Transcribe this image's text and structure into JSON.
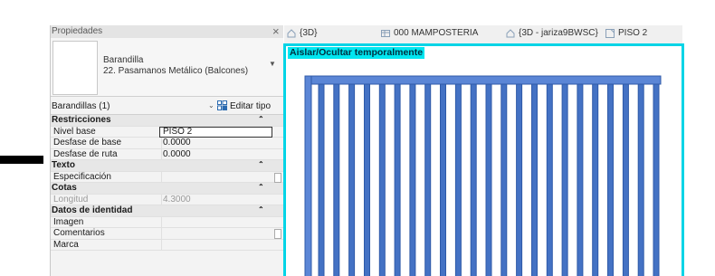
{
  "properties_panel": {
    "title": "Propiedades",
    "close_glyph": "×",
    "type_selector": {
      "family": "Barandilla",
      "type_name": "22. Pasamanos Metálico (Balcones)"
    },
    "instance_filter": "Barandillas (1)",
    "edit_type_label": "Editar tipo",
    "groups": [
      {
        "label": "Restricciones",
        "params": [
          {
            "label": "Nivel base",
            "value": "PISO 2"
          },
          {
            "label": "Desfase de base",
            "value": "0.0000"
          },
          {
            "label": "Desfase de ruta",
            "value": "0.0000"
          }
        ]
      },
      {
        "label": "Texto",
        "params": [
          {
            "label": "Especificación",
            "value": ""
          }
        ]
      },
      {
        "label": "Cotas",
        "params": [
          {
            "label": "Longitud",
            "value": "4.3000"
          }
        ]
      },
      {
        "label": "Datos de identidad",
        "params": [
          {
            "label": "Imagen",
            "value": ""
          },
          {
            "label": "Comentarios",
            "value": ""
          },
          {
            "label": "Marca",
            "value": ""
          }
        ]
      }
    ]
  },
  "view_tabs": [
    "{3D}",
    "000 MAMPOSTERIA",
    "{3D - jariza9BWSC}",
    "PISO 2"
  ],
  "view": {
    "mode_label": "Aislar/Ocultar temporalmente",
    "border_color": "#00d4e6",
    "railing_color": "#4472c4",
    "baluster_count": 23
  }
}
